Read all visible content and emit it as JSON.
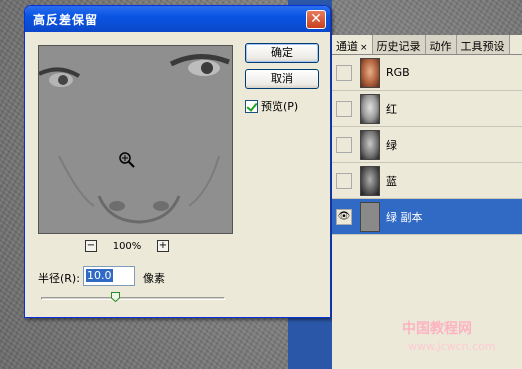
{
  "dialog": {
    "title": "高反差保留",
    "close_glyph": "✕",
    "ok_label": "确定",
    "cancel_label": "取消",
    "preview_label": "预览(P)",
    "zoom_minus": "−",
    "zoom_value": "100%",
    "zoom_plus": "+",
    "radius_label": "半径(R):",
    "radius_value": "10.0",
    "radius_unit": "像素"
  },
  "panel": {
    "tabs": [
      {
        "label": "通道",
        "close": "×"
      },
      {
        "label": "历史记录"
      },
      {
        "label": "动作"
      },
      {
        "label": "工具预设"
      }
    ],
    "channels": [
      {
        "label": "RGB"
      },
      {
        "label": "红"
      },
      {
        "label": "绿"
      },
      {
        "label": "蓝"
      },
      {
        "label": "绿 副本",
        "eye": "👁"
      }
    ]
  },
  "watermark": {
    "text": "中国教程网",
    "url": "www.jcwcn.com"
  },
  "colors": {
    "accent": "#316ac5",
    "title_bar": "#0a54e3"
  }
}
